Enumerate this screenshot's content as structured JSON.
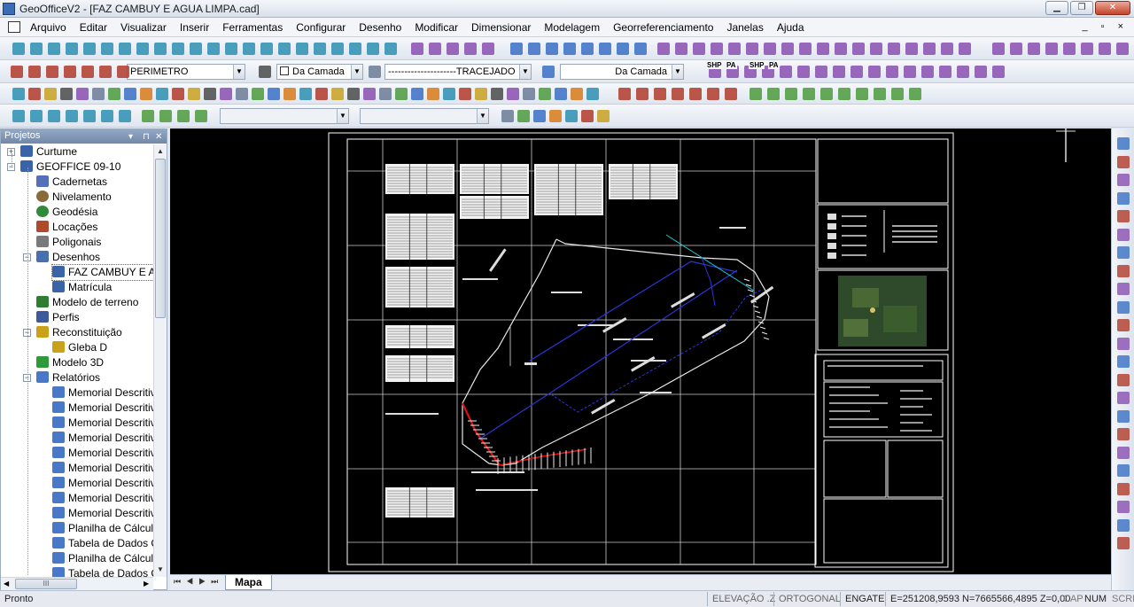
{
  "window": {
    "title": "GeoOfficeV2 - [FAZ CAMBUY E AGUA LIMPA.cad]",
    "buttons": [
      "minimize",
      "restore",
      "close"
    ]
  },
  "menu": {
    "items": [
      "Arquivo",
      "Editar",
      "Visualizar",
      "Inserir",
      "Ferramentas",
      "Configurar",
      "Desenho",
      "Modificar",
      "Dimensionar",
      "Modelagem",
      "Georreferenciamento",
      "Janelas",
      "Ajuda"
    ],
    "mdi_controls": "_ ▫ ×"
  },
  "layer_toolbar": {
    "layer_value": "PERIMETRO",
    "color_value": "Da Camada",
    "linetype_value": "---------------------TRACEJADO",
    "lineweight_value": "Da Camada",
    "shp_label": "SHP",
    "pa_label": "PA"
  },
  "projects_panel": {
    "title": "Projetos",
    "pin": "▾",
    "close": "✕",
    "nodes": [
      {
        "label": "Curtume",
        "icon": "drawing-icon",
        "level": 0,
        "exp": "+"
      },
      {
        "label": "GEOFFICE 09-10",
        "icon": "drawing-icon",
        "level": 0,
        "exp": "-"
      },
      {
        "label": "Cadernetas",
        "icon": "table-icon",
        "level": 1
      },
      {
        "label": "Nivelamento",
        "icon": "level-icon",
        "level": 1
      },
      {
        "label": "Geodésia",
        "icon": "globe-icon",
        "level": 1
      },
      {
        "label": "Locações",
        "icon": "house-icon",
        "level": 1
      },
      {
        "label": "Poligonais",
        "icon": "traverse-icon",
        "level": 1
      },
      {
        "label": "Desenhos",
        "icon": "folder-drawing-icon",
        "level": 1,
        "exp": "-"
      },
      {
        "label": "FAZ CAMBUY E AG",
        "icon": "drawing-icon",
        "level": 2,
        "selected": true
      },
      {
        "label": "Matrícula",
        "icon": "drawing-icon",
        "level": 2
      },
      {
        "label": "Modelo de terreno",
        "icon": "terrain-icon",
        "level": 1
      },
      {
        "label": "Perfis",
        "icon": "profile-icon",
        "level": 1
      },
      {
        "label": "Reconstituição",
        "icon": "reconstitution-icon",
        "level": 1,
        "exp": "-"
      },
      {
        "label": "Gleba D",
        "icon": "reconstitution-icon",
        "level": 2
      },
      {
        "label": "Modelo 3D",
        "icon": "model3d-icon",
        "level": 1
      },
      {
        "label": "Relatórios",
        "icon": "report-icon",
        "level": 1,
        "exp": "-"
      },
      {
        "label": "Memorial Descritiv",
        "icon": "report-icon",
        "level": 2
      },
      {
        "label": "Memorial Descritiv",
        "icon": "report-icon",
        "level": 2
      },
      {
        "label": "Memorial Descritiv",
        "icon": "report-icon",
        "level": 2
      },
      {
        "label": "Memorial Descritiv",
        "icon": "report-icon",
        "level": 2
      },
      {
        "label": "Memorial Descritiv",
        "icon": "report-icon",
        "level": 2
      },
      {
        "label": "Memorial Descritiv",
        "icon": "report-icon",
        "level": 2
      },
      {
        "label": "Memorial Descritiv",
        "icon": "report-icon",
        "level": 2
      },
      {
        "label": "Memorial Descritiv",
        "icon": "report-icon",
        "level": 2
      },
      {
        "label": "Memorial Descritiv",
        "icon": "report-icon",
        "level": 2
      },
      {
        "label": "Planilha de Cálculo",
        "icon": "report-icon",
        "level": 2
      },
      {
        "label": "Tabela de Dados C.",
        "icon": "report-icon",
        "level": 2
      },
      {
        "label": "Planilha de Cálculo",
        "icon": "report-icon",
        "level": 2
      },
      {
        "label": "Tabela de Dados C.",
        "icon": "report-icon",
        "level": 2
      }
    ],
    "hscroll_grip": "III"
  },
  "drawing": {
    "tab_label": "Mapa",
    "tab_nav": "⏮◀▶⏭"
  },
  "status": {
    "ready": "Pronto",
    "elevation": "ELEVAÇÃO .Z",
    "ortho": "ORTOGONAL",
    "snap": "ENGATE",
    "coords": "E=251208,9593 N=7665566,4895 Z=0,00",
    "cap": "CAP",
    "num": "NUM",
    "scrl": "SCRL"
  },
  "colors": {
    "canvas_bg": "#000000",
    "boundary_red": "#e01010",
    "blue_lines": "#2a36d8",
    "cyan_marks": "#20c8d0",
    "accent": "#3b6db4"
  }
}
